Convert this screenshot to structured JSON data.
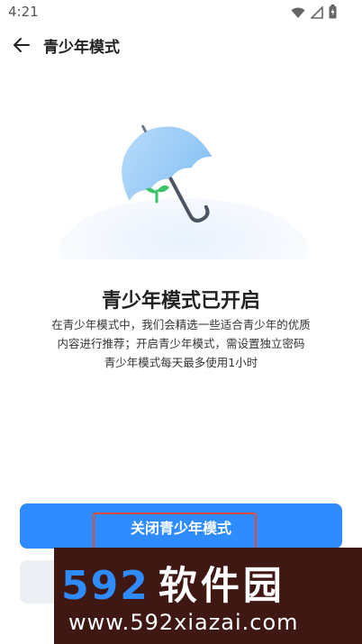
{
  "status_bar": {
    "time": "4:21"
  },
  "header": {
    "title": "青少年模式"
  },
  "main": {
    "headline": "青少年模式已开启",
    "description_lines": [
      "在青少年模式中，我们会精选一些适合青少年的优质",
      "内容进行推荐；开启青少年模式，需设置独立密码",
      "青少年模式每天最多使用1小时"
    ],
    "primary_button_label": "关闭青少年模式"
  },
  "watermark": {
    "big_number": "592",
    "big_text": "软件园",
    "url": "www.592xiazai.com"
  },
  "colors": {
    "accent": "#2f8cff",
    "highlight_border": "#e24b3b",
    "secondary_button": "#eceff3",
    "watermark_bg": "#3f1713"
  },
  "icons": [
    "back-arrow-icon",
    "wifi-icon",
    "signal-icon",
    "battery-icon",
    "umbrella-illustration"
  ]
}
